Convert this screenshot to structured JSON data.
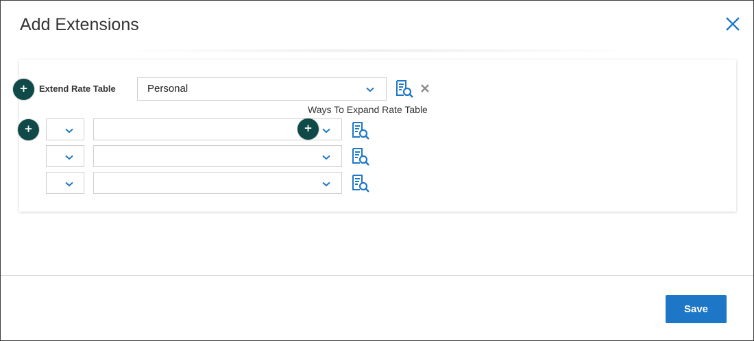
{
  "dialog": {
    "title": "Add Extensions",
    "close_icon": "close-icon"
  },
  "extend_rate_table": {
    "label": "Extend Rate Table",
    "selected": "Personal",
    "add_icon": "plus-icon",
    "lookup_icon": "document-search-icon",
    "remove_icon": "close-icon"
  },
  "ways_to_expand": {
    "label": "Ways To Expand Rate Table",
    "rows": [
      {
        "first_select": "",
        "second_select": ""
      },
      {
        "first_select": "",
        "second_select": ""
      },
      {
        "first_select": "",
        "second_select": ""
      }
    ]
  },
  "footer": {
    "save_label": "Save"
  },
  "colors": {
    "accent": "#1d77c6",
    "add_button": "#0f4a48",
    "title_text": "#333333"
  }
}
